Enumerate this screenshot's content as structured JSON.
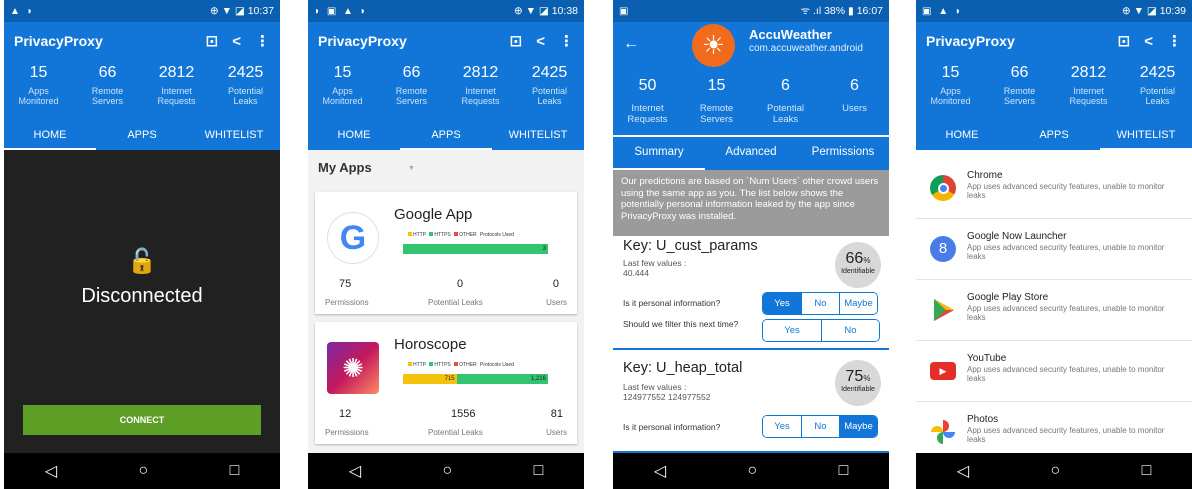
{
  "common": {
    "app_title": "PrivacyProxy",
    "stats": [
      {
        "value": "15",
        "label": "Apps Monitored"
      },
      {
        "value": "66",
        "label": "Remote Servers"
      },
      {
        "value": "2812",
        "label": "Internet Requests"
      },
      {
        "value": "2425",
        "label": "Potential Leaks"
      }
    ],
    "tabs": [
      "HOME",
      "APPS",
      "WHITELIST"
    ],
    "nav": {
      "back": "◁",
      "home": "○",
      "recents": "□"
    }
  },
  "screen1": {
    "status_left": "▲ ◗",
    "status_right": "⊕ ▼ ◪ 10:37",
    "lock_icon": "🔓",
    "state": "Disconnected",
    "button": "CONNECT"
  },
  "screen2": {
    "status_left": "◗ ▣ ▲ ◗",
    "status_right": "⊕ ▼ ◪ 10:38",
    "section": "My Apps",
    "caret": "▼",
    "legend": [
      "HTTP",
      "HTTPS",
      "OTHER",
      "Protocols Used"
    ],
    "colors": {
      "http": "#f4c20d",
      "https": "#33c472",
      "other": "#e94b3c"
    },
    "apps": [
      {
        "name": "Google App",
        "bar_https": "3",
        "bar_http": "",
        "permissions": "75",
        "leaks": "0",
        "users": "0"
      },
      {
        "name": "Horoscope",
        "bar_http": "715",
        "bar_https": "1,216",
        "permissions": "12",
        "leaks": "1556",
        "users": "81"
      }
    ],
    "labels": {
      "permissions": "Permissions",
      "leaks": "Potential Leaks",
      "users": "Users"
    }
  },
  "screen3": {
    "status_left": "▣",
    "status_right": "ᯤ .ıl 38% ▮ 16:07",
    "back_icon": "←",
    "app_name": "AccuWeather",
    "package": "com.accuweather.android",
    "logo_glyph": "☀",
    "stats": [
      {
        "value": "50",
        "label": "Internet Requests"
      },
      {
        "value": "15",
        "label": "Remote Servers"
      },
      {
        "value": "6",
        "label": "Potential Leaks"
      },
      {
        "value": "6",
        "label": "Users"
      }
    ],
    "tabs": [
      "Summary",
      "Advanced",
      "Permissions"
    ],
    "notice": "Our predictions are based on `Num Users` other crowd users using the same app as you. The list below shows the potentially personal information leaked by the app since PrivacyProxy was installed.",
    "keys": [
      {
        "name": "Key:  U_cust_params",
        "lfv_label": "Last few values :",
        "lfv": "40.444",
        "pct": "66",
        "pct_unit": "%",
        "ident": "Identifiable",
        "q1": "Is it personal information?",
        "q1_opts": [
          "Yes",
          "No",
          "Maybe"
        ],
        "q2": "Should we filter this next time?",
        "q2_opts": [
          "Yes",
          "No"
        ]
      },
      {
        "name": "Key:  U_heap_total",
        "lfv_label": "Last few values :",
        "lfv": "124977552 124977552",
        "pct": "75",
        "pct_unit": "%",
        "ident": "Identifiable",
        "q1": "Is it personal information?",
        "q1_opts": [
          "Yes",
          "No",
          "Maybe"
        ]
      }
    ]
  },
  "screen4": {
    "status_left": "▣ ▲ ◗",
    "status_right": "⊕ ▼ ◪ 10:39",
    "items": [
      {
        "name": "Chrome",
        "desc": "App uses advanced security features, unable to monitor leaks"
      },
      {
        "name": "Google Now Launcher",
        "desc": "App uses advanced security features, unable to monitor leaks"
      },
      {
        "name": "Google Play Store",
        "desc": "App uses advanced security features, unable to monitor leaks"
      },
      {
        "name": "YouTube",
        "desc": "App uses advanced security features, unable to monitor leaks"
      },
      {
        "name": "Photos",
        "desc": "App uses advanced security features, unable to monitor leaks"
      }
    ]
  }
}
